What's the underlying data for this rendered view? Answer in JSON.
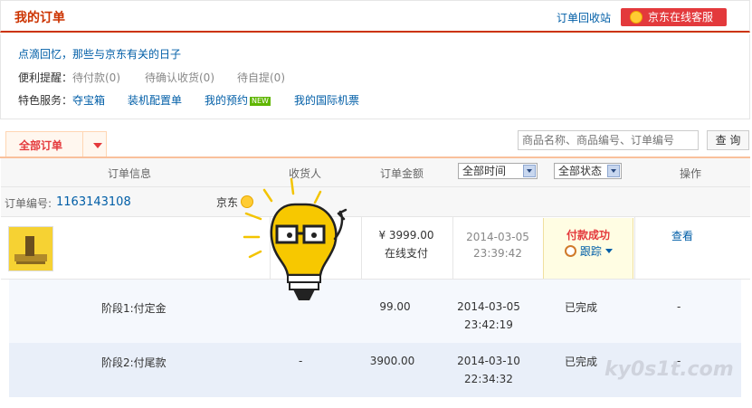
{
  "header": {
    "title": "我的订单",
    "recycle_link": "订单回收站",
    "service_button": "京东在线客服"
  },
  "info": {
    "memory_link": "点滴回忆，那些与京东有关的日子",
    "reminder_label": "便利提醒：",
    "reminders": [
      "待付款(0)",
      "待确认收货(0)",
      "待自提(0)"
    ],
    "features_label": "特色服务：",
    "features": [
      "夺宝箱",
      "装机配置单",
      "我的预约",
      "我的国际机票"
    ],
    "new_badge": "NEW"
  },
  "tabs": {
    "all_orders": "全部订单"
  },
  "search": {
    "placeholder": "商品名称、商品编号、订单编号",
    "button": "查 询"
  },
  "table": {
    "headers": {
      "order_info": "订单信息",
      "receiver": "收货人",
      "amount": "订单金额",
      "time_filter": "全部时间",
      "status_filter": "全部状态",
      "action": "操作"
    },
    "order": {
      "id_label": "订单编号:",
      "id": "1163143108",
      "shop": "京东",
      "amount": "¥ 3999.00",
      "pay_method": "在线支付",
      "date": "2014-03-05",
      "time": "23:39:42",
      "status": "付款成功",
      "track": "跟踪",
      "view": "查看"
    },
    "stages": [
      {
        "name": "阶段1:付定金",
        "receiver": "",
        "amount": "99.00",
        "date": "2014-03-05",
        "time": "23:42:19",
        "status": "已完成",
        "action": "-"
      },
      {
        "name": "阶段2:付尾款",
        "receiver": "-",
        "amount": "3900.00",
        "date": "2014-03-10",
        "time": "22:34:32",
        "status": "已完成",
        "action": "-"
      }
    ]
  },
  "watermark": "ky0s1t.com"
}
